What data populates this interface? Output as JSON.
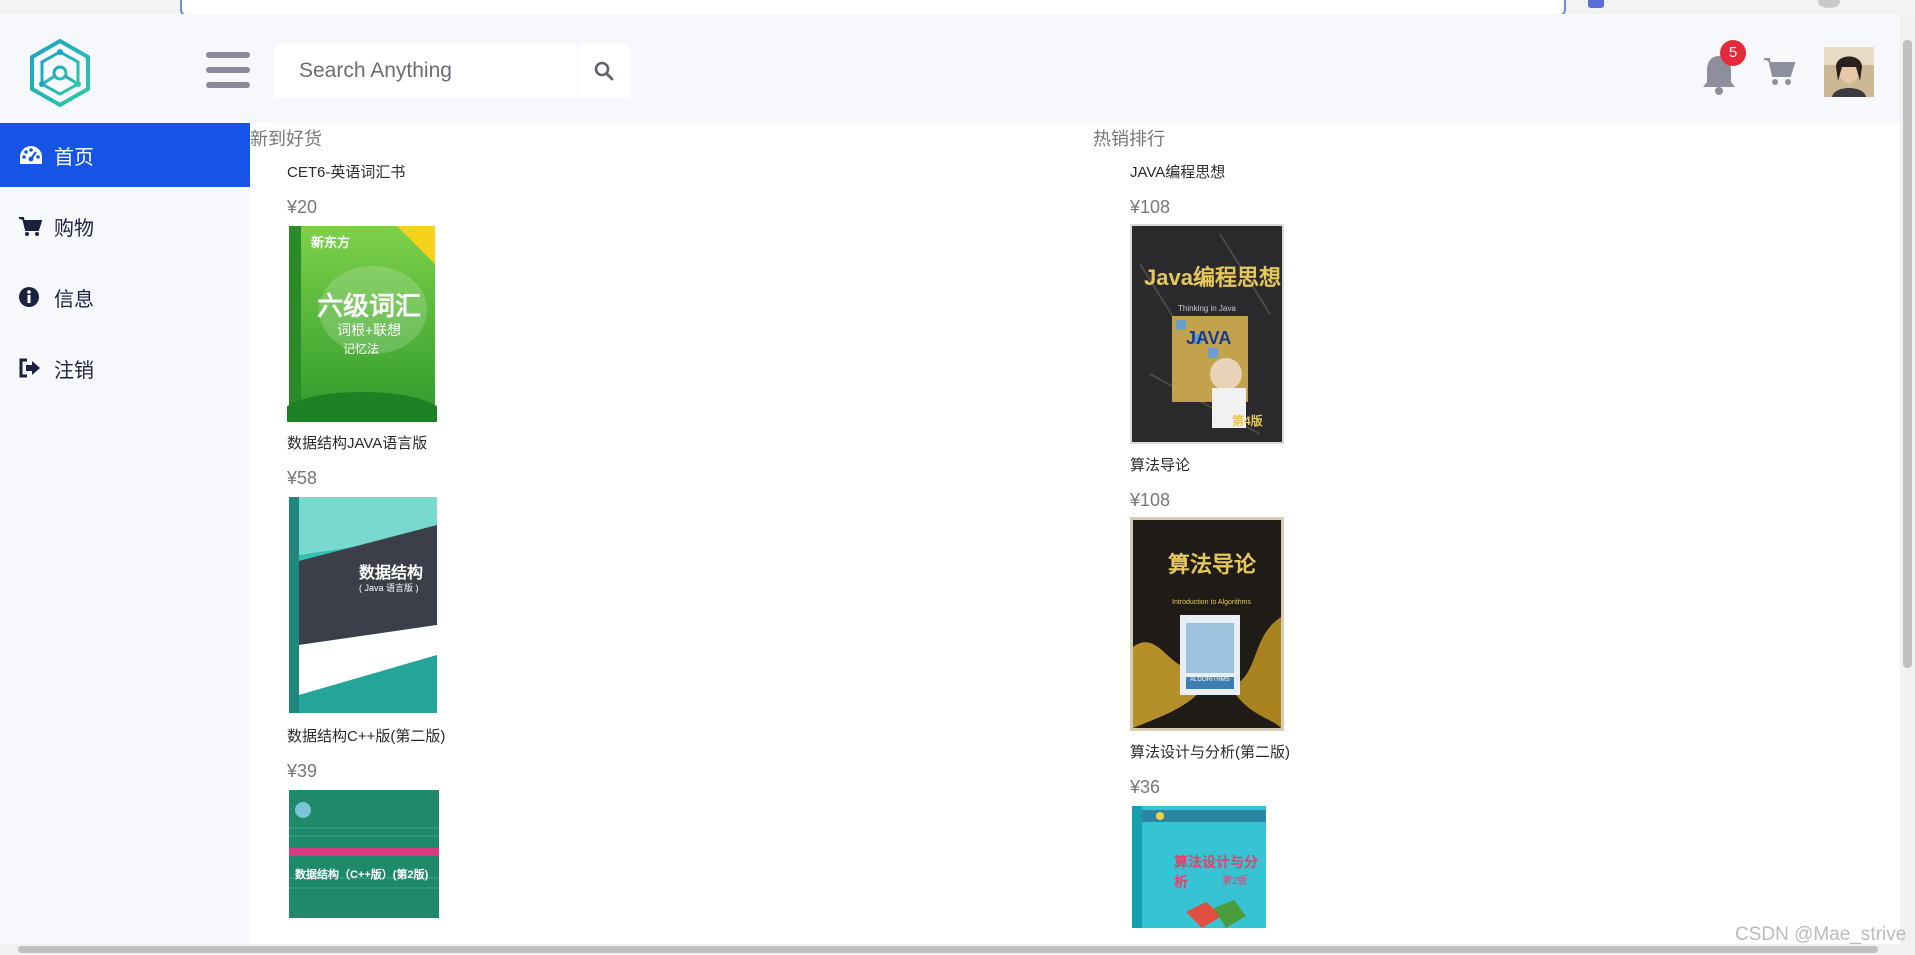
{
  "header": {
    "search": {
      "placeholder": "Search Anything"
    },
    "notifications": {
      "count": "5"
    }
  },
  "sidebar": {
    "items": [
      {
        "label": "首页",
        "icon": "dashboard-icon",
        "active": true
      },
      {
        "label": "购物",
        "icon": "cart-icon"
      },
      {
        "label": "信息",
        "icon": "info-icon"
      },
      {
        "label": "注销",
        "icon": "sign-out-icon"
      }
    ]
  },
  "main": {
    "new_arrivals": {
      "title": "新到好货",
      "products": [
        {
          "name": "CET6-英语词汇书",
          "price": "¥20",
          "cover_title": "六级词汇",
          "cover_subtitle": "词根+联想",
          "cover_subtitle2": "记忆法",
          "cover_brand": "新东方"
        },
        {
          "name": "数据结构JAVA语言版",
          "price": "¥58",
          "cover_title": "数据结构",
          "cover_subtitle": "( Java 语言版 )"
        },
        {
          "name": "数据结构C++版(第二版)",
          "price": "¥39",
          "cover_title": "数据结构（C++版）(第2版)"
        }
      ]
    },
    "best_sellers": {
      "title": "热销排行",
      "products": [
        {
          "name": "JAVA编程思想",
          "price": "¥108",
          "cover_title": "Java编程思想",
          "cover_subtitle": "Thinking in Java",
          "cover_subtitle2": "JAVA",
          "cover_edition": "第4版"
        },
        {
          "name": "算法导论",
          "price": "¥108",
          "cover_title": "算法导论",
          "cover_subtitle": "Introduction to Algorithms",
          "cover_subtitle2": "ALGORITHMS"
        },
        {
          "name": "算法设计与分析(第二版)",
          "price": "¥36",
          "cover_title": "算法设计与分析",
          "cover_subtitle": "第2版"
        }
      ]
    }
  },
  "watermark": "CSDN @Mae_strive",
  "colors": {
    "accent": "#1554e6",
    "badge": "#e52b3b",
    "sidebar_bg": "#f7f8fc"
  }
}
